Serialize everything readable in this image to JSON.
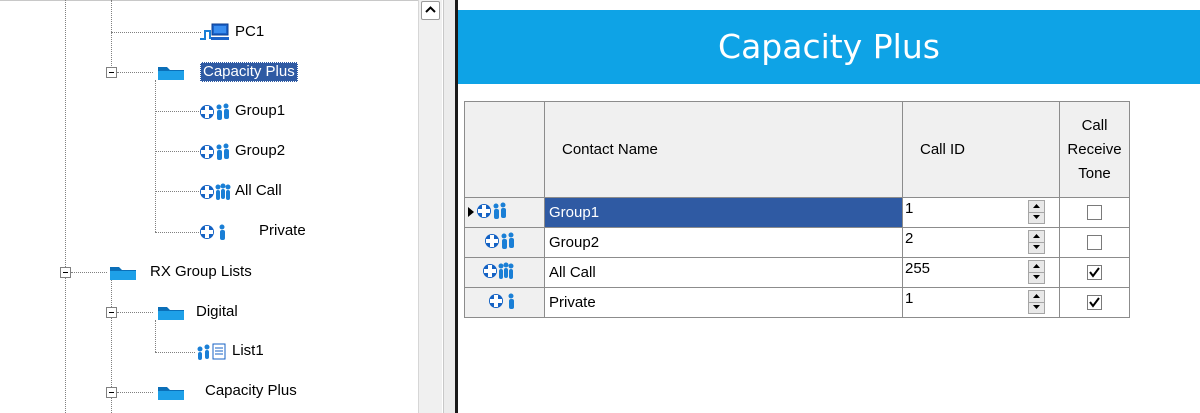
{
  "tree": {
    "nodes": [
      {
        "label": "PC1",
        "icon": "pc-connection-icon"
      },
      {
        "label": "Capacity Plus",
        "icon": "folder-icon",
        "selected": true
      },
      {
        "label": "Group1",
        "icon": "group-contact-icon"
      },
      {
        "label": "Group2",
        "icon": "group-contact-icon"
      },
      {
        "label": "All Call",
        "icon": "all-call-contact-icon"
      },
      {
        "label": "Private",
        "icon": "private-contact-icon"
      },
      {
        "label": "RX Group Lists",
        "icon": "folder-icon"
      },
      {
        "label": "Digital",
        "icon": "folder-icon"
      },
      {
        "label": "List1",
        "icon": "rx-group-list-icon"
      },
      {
        "label": "Capacity Plus",
        "icon": "folder-icon"
      }
    ]
  },
  "panel": {
    "title": "Capacity Plus",
    "header_color": "#0ea3e6",
    "columns": {
      "name": "Contact Name",
      "call_id": "Call ID",
      "tone_line1": "Call",
      "tone_line2": "Receive",
      "tone_line3": "Tone"
    },
    "rows": [
      {
        "name": "Group1",
        "call_id": "1",
        "receive_tone": false,
        "icon": "group-contact-icon",
        "current": true
      },
      {
        "name": "Group2",
        "call_id": "2",
        "receive_tone": false,
        "icon": "group-contact-icon"
      },
      {
        "name": "All Call",
        "call_id": "255",
        "receive_tone": true,
        "icon": "all-call-contact-icon"
      },
      {
        "name": "Private",
        "call_id": "1",
        "receive_tone": true,
        "icon": "private-contact-icon"
      }
    ]
  }
}
